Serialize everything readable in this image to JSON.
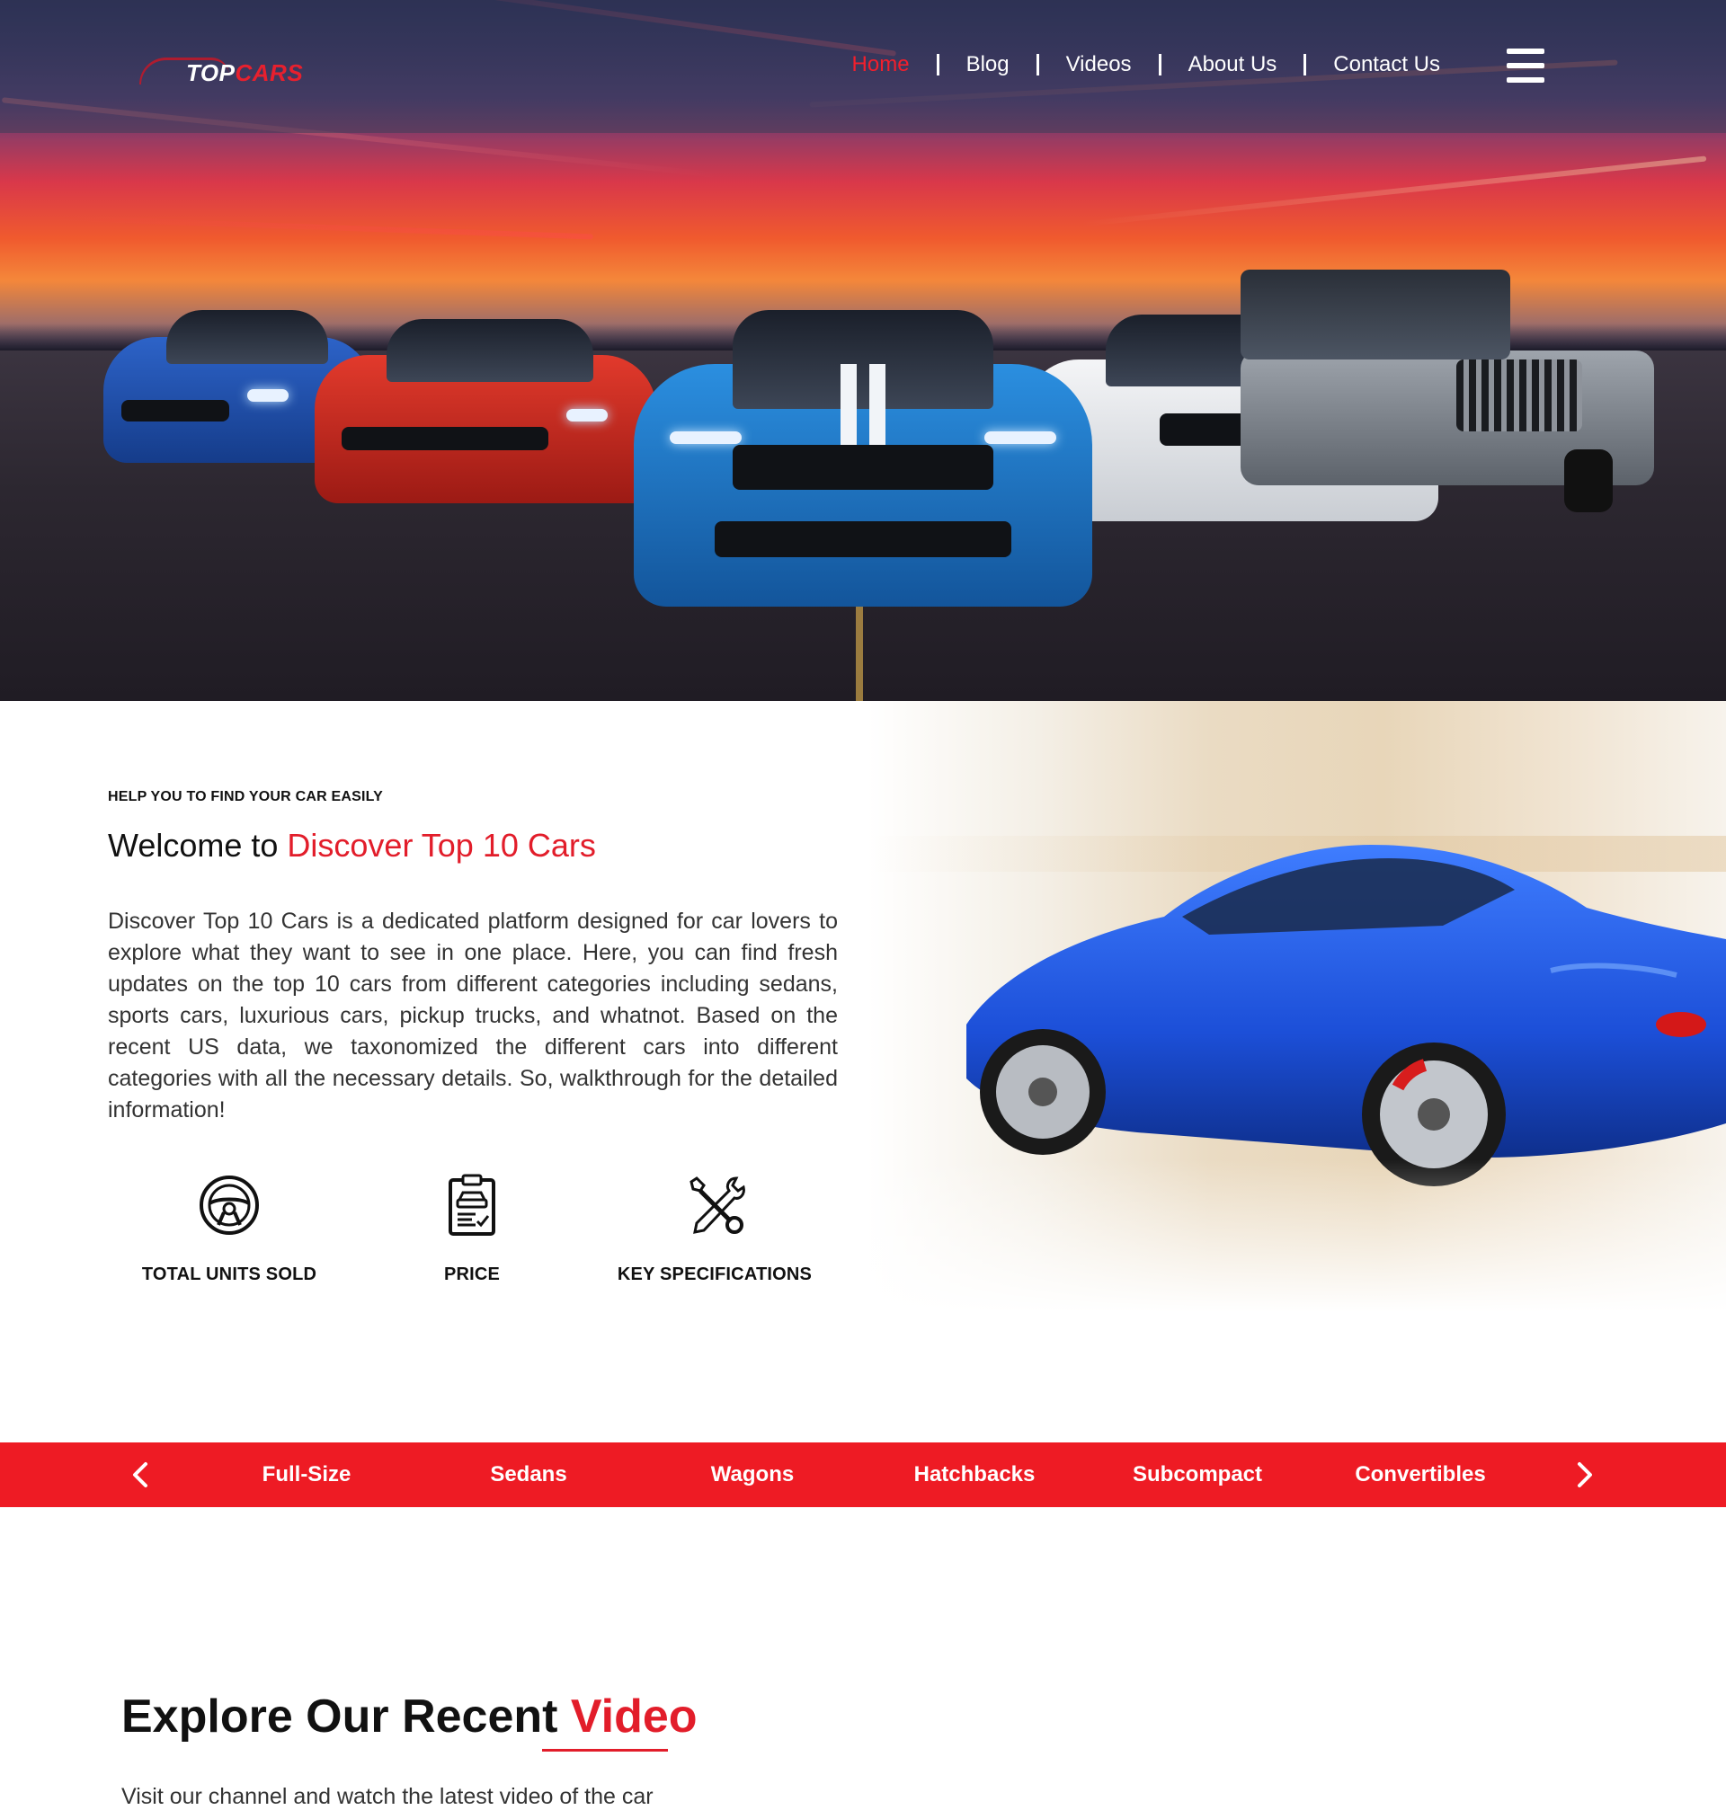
{
  "brand": {
    "logo_top": "TOP",
    "logo_cars": "CARS"
  },
  "nav": {
    "items": [
      {
        "label": "Home",
        "active": true
      },
      {
        "label": "Blog",
        "active": false
      },
      {
        "label": "Videos",
        "active": false
      },
      {
        "label": "About Us",
        "active": false
      },
      {
        "label": "Contact Us",
        "active": false
      }
    ],
    "menu_icon": "hamburger-menu-icon"
  },
  "welcome": {
    "eyebrow": "HELP YOU TO FIND YOUR CAR EASILY",
    "title_prefix": "Welcome to ",
    "title_accent": "Discover Top 10 Cars",
    "body": "Discover Top 10 Cars is a dedicated platform designed for car lovers to explore what they want to see in one place. Here, you can find fresh updates on the top 10 cars from different categories including sedans, sports cars, luxurious cars, pickup trucks, and whatnot. Based on the recent US data, we taxonomized the different cars into different categories with all the necessary details. So, walkthrough for the detailed information!",
    "features": [
      {
        "label": "TOTAL UNITS SOLD",
        "icon": "steering-wheel-icon"
      },
      {
        "label": "PRICE",
        "icon": "price-clipboard-icon"
      },
      {
        "label": "KEY SPECIFICATIONS",
        "icon": "wrench-screwdriver-icon"
      }
    ]
  },
  "categories": {
    "items": [
      "Full-Size",
      "Sedans",
      "Wagons",
      "Hatchbacks",
      "Subcompact",
      "Convertibles"
    ],
    "prev_icon": "chevron-left-icon",
    "next_icon": "chevron-right-icon"
  },
  "explore": {
    "title_prefix": "Explore Our Recent ",
    "title_accent": "Video",
    "subtitle": "Visit our channel and watch the latest video of the car"
  },
  "colors": {
    "accent": "#ee1b24",
    "nav_active": "#f21f2c",
    "text": "#111111"
  }
}
